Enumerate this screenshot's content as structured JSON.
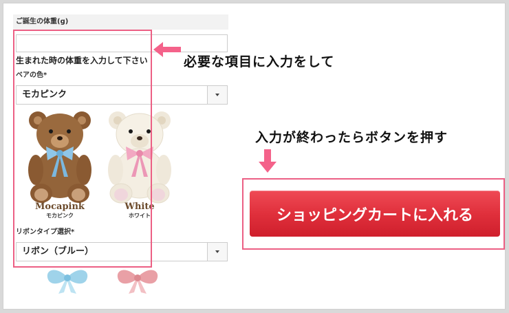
{
  "form": {
    "weight_label": "ご誕生の体重(g)",
    "weight_value": "",
    "weight_hint": "生まれた時の体重を入力して下さい",
    "bear_color_label": "ベアの色*",
    "bear_color_selected": "モカピンク",
    "bears": [
      {
        "name": "Mocapink",
        "kana": "モカピンク"
      },
      {
        "name": "White",
        "kana": "ホワイト"
      }
    ],
    "ribbon_label": "リボンタイプ選択*",
    "ribbon_selected": "リボン（ブルー）"
  },
  "annotations": {
    "input_instruction": "必要な項目に入力をして",
    "button_instruction": "入力が終わったらボタンを押す"
  },
  "cart": {
    "button_label": "ショッピングカートに入れる"
  },
  "colors": {
    "highlight_pink": "#ec5f84",
    "button_red": "#e0303c",
    "arrow_pink": "#f4628a"
  }
}
